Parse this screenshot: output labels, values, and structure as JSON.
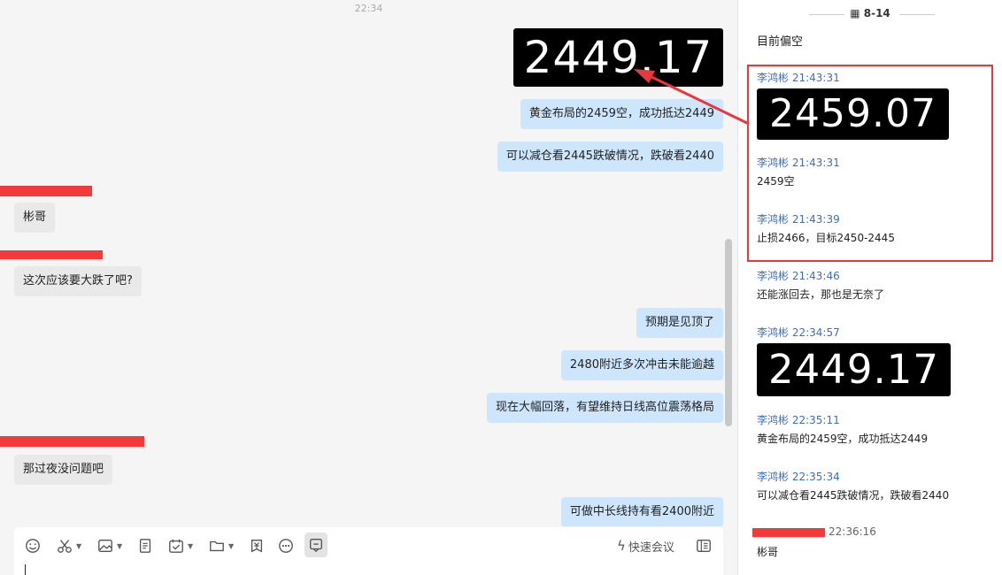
{
  "chat": {
    "top_time": "22:34",
    "image_value_1": "2449.17",
    "messages_out": [
      "黄金布局的2459空，成功抵达2449",
      "可以减仓看2445跌破情况，跌破看2440",
      "预期是见顶了",
      "2480附近多次冲击未能逾越",
      "现在大幅回落，有望维持日线高位震荡格局",
      "可做中长线持有看2400附近"
    ],
    "messages_in": [
      "彬哥",
      "这次应该要大跌了吧?",
      "那过夜没问题吧"
    ]
  },
  "composer": {
    "quick_meeting": "快速会议",
    "icons": [
      "emoji-icon",
      "scissors-icon",
      "image-icon",
      "document-icon",
      "calendar-check-icon",
      "folder-icon",
      "red-packet-icon",
      "more-icon",
      "chat-record-icon",
      "sidebar-icon"
    ]
  },
  "side": {
    "date": "8-14",
    "first_text": "目前偏空",
    "entries": [
      {
        "meta": "李鸿彬 21:43:31",
        "image": "2459.07"
      },
      {
        "meta": "李鸿彬 21:43:31",
        "text": "2459空"
      },
      {
        "meta": "李鸿彬 21:43:39",
        "text": "止损2466，目标2450-2445"
      },
      {
        "meta": "李鸿彬 21:43:46",
        "text": "还能涨回去，那也是无奈了"
      },
      {
        "meta": "李鸿彬 22:34:57",
        "image": "2449.17"
      },
      {
        "meta": "李鸿彬 22:35:11",
        "text": "黄金布局的2459空，成功抵达2449"
      },
      {
        "meta": "李鸿彬 22:35:34",
        "text": "可以减仓看2445跌破情况，跌破看2440"
      }
    ],
    "last_time": "22:36:16",
    "last_text": "彬哥"
  },
  "colors": {
    "bubble_out": "#cde6fc",
    "bubble_in": "#e9e9e9",
    "accent_red": "#e8383d",
    "meta_blue": "#3b6fc1"
  }
}
